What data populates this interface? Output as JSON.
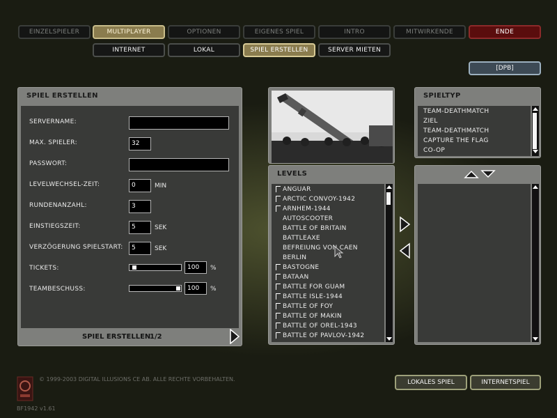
{
  "nav": {
    "top": [
      "EINZELSPIELER",
      "MULTIPLAYER",
      "OPTIONEN",
      "EIGENES SPIEL",
      "INTRO",
      "MITWIRKENDE",
      "ENDE"
    ],
    "sub": [
      "INTERNET",
      "LOKAL",
      "SPIEL ERSTELLEN",
      "SERVER MIETEN"
    ],
    "selected_top": "MULTIPLAYER",
    "selected_sub": "SPIEL ERSTELLEN"
  },
  "dpb_label": "[DPB]",
  "form": {
    "title": "SPIEL ERSTELLEN",
    "servername_label": "SERVERNAME:",
    "servername_value": "",
    "max_players_label": "MAX. SPIELER:",
    "max_players_value": "32",
    "password_label": "PASSWORT:",
    "password_value": "",
    "level_change_label": "LEVELWECHSEL-ZEIT:",
    "level_change_value": "0",
    "level_change_unit": "MIN",
    "rounds_label": "RUNDENANZAHL:",
    "rounds_value": "3",
    "spawn_label": "EINSTIEGSZEIT:",
    "spawn_value": "5",
    "spawn_unit": "SEK",
    "start_delay_label": "VERZÖGERUNG SPIELSTART:",
    "start_delay_value": "5",
    "start_delay_unit": "SEK",
    "tickets_label": "TICKETS:",
    "tickets_value": "100",
    "tickets_unit": "%",
    "tickets_level": 0.05,
    "friendly_fire_label": "TEAMBESCHUSS:",
    "friendly_fire_value": "100",
    "friendly_fire_unit": "%",
    "friendly_fire_level": 1.0,
    "footer": "SPIEL ERSTELLEN",
    "page": "1/2"
  },
  "gametype": {
    "title": "SPIELTYP",
    "items": [
      "TEAM-DEATHMATCH",
      "ZIEL",
      "TEAM-DEATHMATCH",
      "CAPTURE THE FLAG",
      "CO-OP"
    ]
  },
  "levels": {
    "title": "LEVELS",
    "items": [
      {
        "name": "ANGUAR",
        "mark": true
      },
      {
        "name": "ARCTIC CONVOY-1942",
        "mark": true
      },
      {
        "name": "ARNHEM-1944",
        "mark": true
      },
      {
        "name": "AUTOSCOOTER",
        "mark": false
      },
      {
        "name": "BATTLE OF BRITAIN",
        "mark": false
      },
      {
        "name": "BATTLEAXE",
        "mark": false
      },
      {
        "name": "BEFREIUNG VON CAEN",
        "mark": false
      },
      {
        "name": "BERLIN",
        "mark": false
      },
      {
        "name": "BASTOGNE",
        "mark": true
      },
      {
        "name": "BATAAN",
        "mark": true
      },
      {
        "name": "BATTLE FOR GUAM",
        "mark": true
      },
      {
        "name": "BATTLE ISLE-1944",
        "mark": true
      },
      {
        "name": "BATTLE OF FOY",
        "mark": true
      },
      {
        "name": "BATTLE OF MAKIN",
        "mark": true
      },
      {
        "name": "BATTLE OF OREL-1943",
        "mark": true
      },
      {
        "name": "BATTLE OF PAVLOV-1942",
        "mark": true
      }
    ]
  },
  "bottom": {
    "copyright": "© 1999-2003 DIGITAL ILLUSIONS CE AB. ALLE RECHTE VORBEHALTEN.",
    "version": "BF1942 v1.61",
    "lan_button": "LOKALES SPIEL",
    "internet_button": "INTERNETSPIEL"
  },
  "colors": {
    "exit": "#5a0d0d",
    "selected": "#8a7c4e"
  }
}
